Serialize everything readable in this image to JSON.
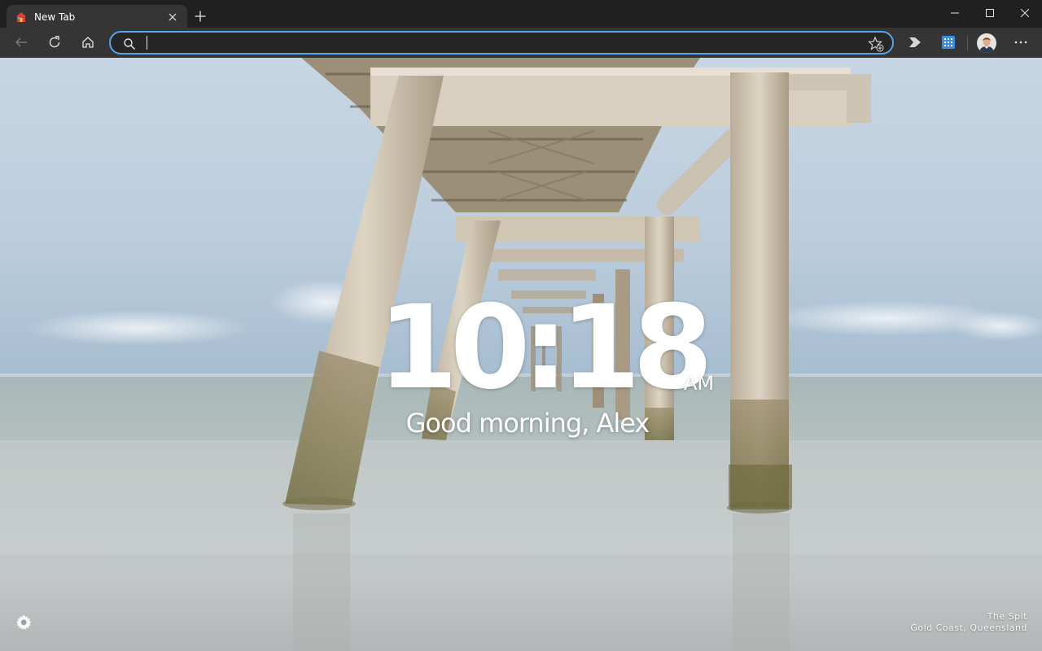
{
  "browser": {
    "tab": {
      "title": "New Tab",
      "favicon": "home-favicon-icon"
    },
    "new_tab_icon": "plus-icon",
    "window_controls": [
      "minimize-icon",
      "maximize-icon",
      "close-icon"
    ],
    "toolbar": {
      "back_icon": "arrow-left-icon",
      "refresh_icon": "refresh-icon",
      "home_icon": "home-icon",
      "extension_icons": [
        "chevron-forward-icon",
        "apps-grid-icon"
      ],
      "menu_icon": "more-horizontal-icon"
    },
    "omnibox": {
      "value": "",
      "placeholder": "",
      "search_icon": "search-icon",
      "favorite_icon": "star-add-icon",
      "focus_color": "#5aa5e6"
    }
  },
  "new_tab_page": {
    "clock": {
      "time": "10:18",
      "ampm": "AM"
    },
    "greeting": "Good morning, Alex",
    "settings_icon": "gear-icon",
    "photo_credit": {
      "title": "The Spit",
      "location": "Gold Coast, Queensland"
    }
  },
  "colors": {
    "titlebar": "#202020",
    "toolbar": "#353535",
    "sky_top": "#c9d8e6",
    "horizon": "#a9bcca",
    "water": "#b6c1c2"
  }
}
